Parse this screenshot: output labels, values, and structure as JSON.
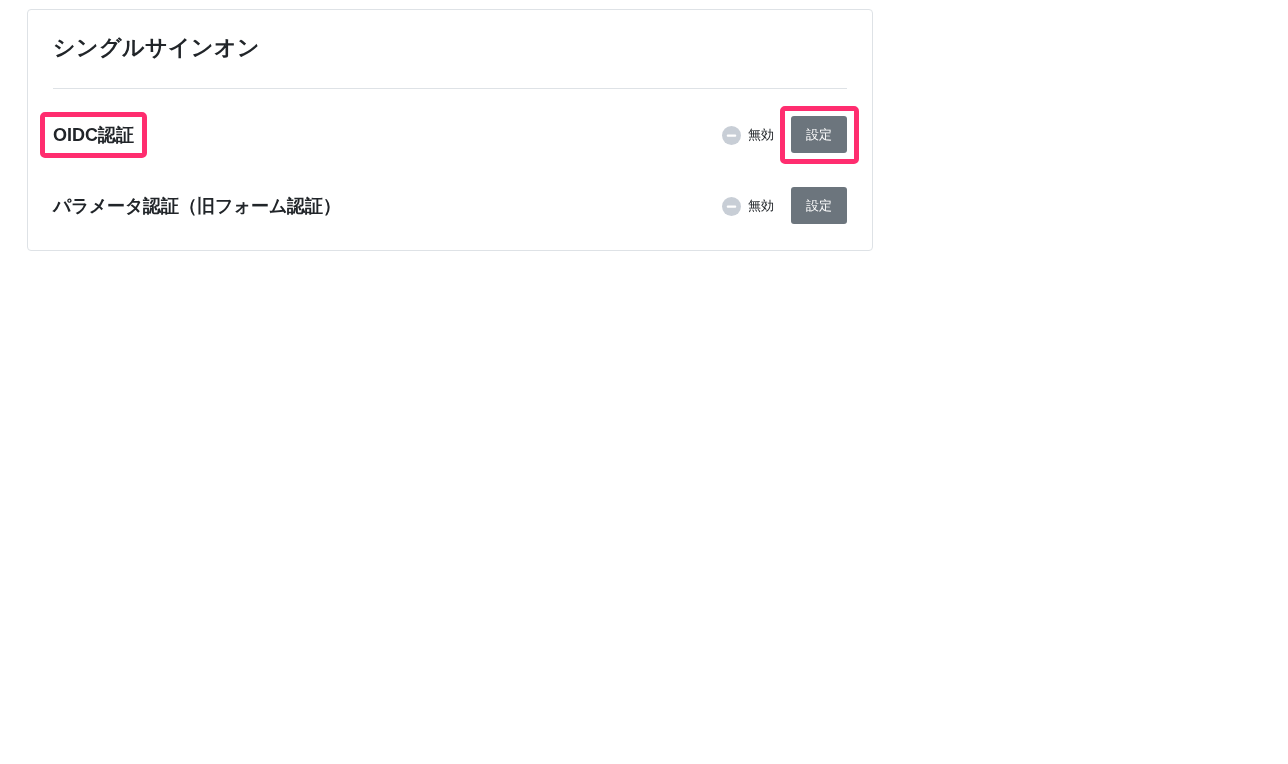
{
  "card": {
    "title": "シングルサインオン",
    "rows": [
      {
        "name": "OIDC認証",
        "name_highlighted": true,
        "status": {
          "enabled": false,
          "label": "無効"
        },
        "button": {
          "label": "設定",
          "highlighted": true
        }
      },
      {
        "name": "パラメータ認証（旧フォーム認証）",
        "name_highlighted": false,
        "status": {
          "enabled": false,
          "label": "無効"
        },
        "button": {
          "label": "設定",
          "highlighted": false
        }
      }
    ]
  }
}
